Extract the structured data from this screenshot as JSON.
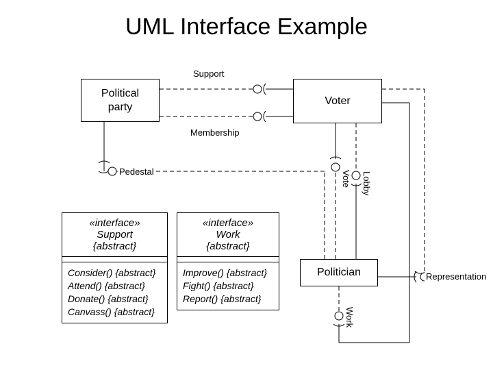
{
  "title": "UML Interface Example",
  "nodes": {
    "political_party": "Political\nparty",
    "voter": "Voter",
    "politician": "Politician"
  },
  "labels": {
    "support": "Support",
    "membership": "Membership",
    "pedestal": "Pedestal",
    "vote": "Vote",
    "lobby": "Lobby",
    "work": "Work",
    "representation": "Representation"
  },
  "interfaces": {
    "support": {
      "stereotype": "«interface»",
      "name": "Support",
      "constraint": "{abstract}",
      "ops": [
        "Consider() {abstract}",
        "Attend() {abstract}",
        "Donate() {abstract}",
        "Canvass() {abstract}"
      ]
    },
    "work": {
      "stereotype": "«interface»",
      "name": "Work",
      "constraint": "{abstract}",
      "ops": [
        "Improve() {abstract}",
        "Fight() {abstract}",
        "Report() {abstract}"
      ]
    }
  }
}
